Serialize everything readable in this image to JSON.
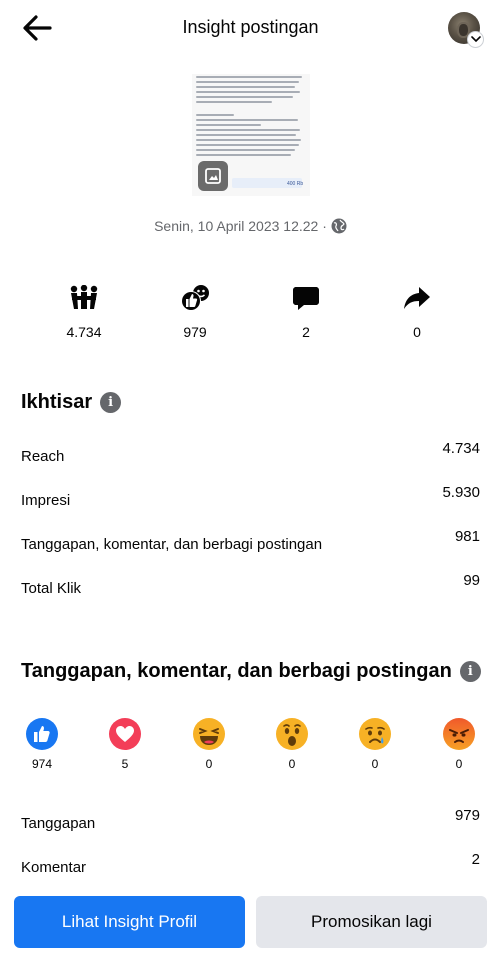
{
  "header": {
    "title": "Insight postingan",
    "back_icon": "arrow-left-icon",
    "avatar_icon": "profile-avatar"
  },
  "post": {
    "thumb_bar_text": "400 Rb",
    "date": "Senin, 10 April 2023 12.22 ·",
    "privacy_icon": "globe-icon"
  },
  "stats": [
    {
      "icon": "reach-icon",
      "value": "4.734"
    },
    {
      "icon": "reactions-icon",
      "value": "979"
    },
    {
      "icon": "comment-icon",
      "value": "2"
    },
    {
      "icon": "share-icon",
      "value": "0"
    }
  ],
  "overview": {
    "title": "Ikhtisar",
    "metrics": [
      {
        "label": "Reach",
        "value": "4.734"
      },
      {
        "label": "Impresi",
        "value": "5.930"
      },
      {
        "label": "Tanggapan, komentar, dan berbagi postingan",
        "value": "981"
      },
      {
        "label": "Total Klik",
        "value": "99"
      }
    ]
  },
  "engagement": {
    "title": "Tanggapan, komentar, dan berbagi postingan",
    "reactions": [
      {
        "name": "like",
        "count": "974",
        "color": "#1877f2"
      },
      {
        "name": "love",
        "count": "5",
        "color": "#f33e58"
      },
      {
        "name": "haha",
        "count": "0",
        "color": "#f7b125"
      },
      {
        "name": "wow",
        "count": "0",
        "color": "#f7b125"
      },
      {
        "name": "sad",
        "count": "0",
        "color": "#f7b125"
      },
      {
        "name": "angry",
        "count": "0",
        "color": "#e9710f"
      }
    ],
    "metrics": [
      {
        "label": "Tanggapan",
        "value": "979"
      },
      {
        "label": "Komentar",
        "value": "2"
      }
    ]
  },
  "buttons": {
    "primary": "Lihat Insight Profil",
    "secondary": "Promosikan lagi"
  },
  "colors": {
    "accent": "#1877f2",
    "secondary_button": "#e4e6eb",
    "muted_text": "#65676b"
  }
}
